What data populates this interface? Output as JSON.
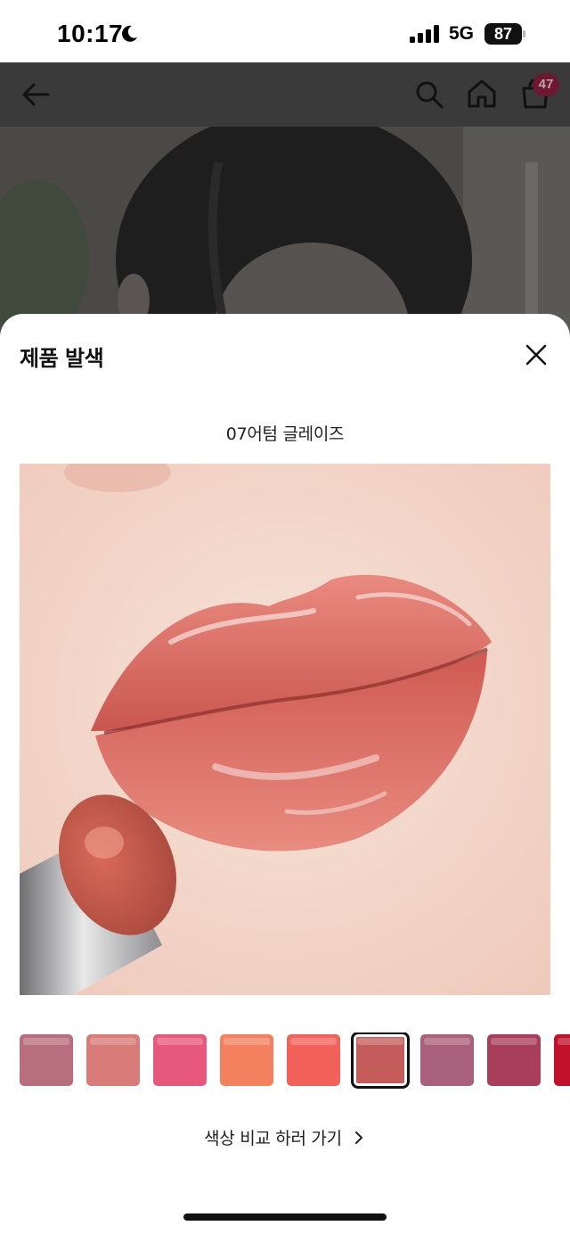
{
  "status_bar": {
    "time": "10:17",
    "network": "5G",
    "battery": "87",
    "icons": [
      "moon-icon",
      "signal-icon",
      "battery-icon"
    ]
  },
  "header": {
    "icons": [
      "back-arrow-icon",
      "search-icon",
      "home-icon",
      "shopping-bag-icon"
    ],
    "cart_count": "47",
    "badge_color": "#6b1830"
  },
  "sheet": {
    "title": "제품 발색",
    "shade_name": "07어텀 글레이즈",
    "compare_link_label": "색상 비교 하러 가기",
    "swatches": [
      {
        "color": "#b86f7d",
        "selected": false
      },
      {
        "color": "#d97b78",
        "selected": false
      },
      {
        "color": "#e8587c",
        "selected": false
      },
      {
        "color": "#f3805e",
        "selected": false
      },
      {
        "color": "#f2625a",
        "selected": false
      },
      {
        "color": "#c45c5c",
        "selected": true
      },
      {
        "color": "#a9607a",
        "selected": false
      },
      {
        "color": "#a83e5a",
        "selected": false
      },
      {
        "color": "#c0102a",
        "selected": false
      }
    ]
  },
  "colors": {
    "sheet_background": "#ffffff",
    "dim_overlay": "#3a3a3a",
    "text": "#111111"
  }
}
